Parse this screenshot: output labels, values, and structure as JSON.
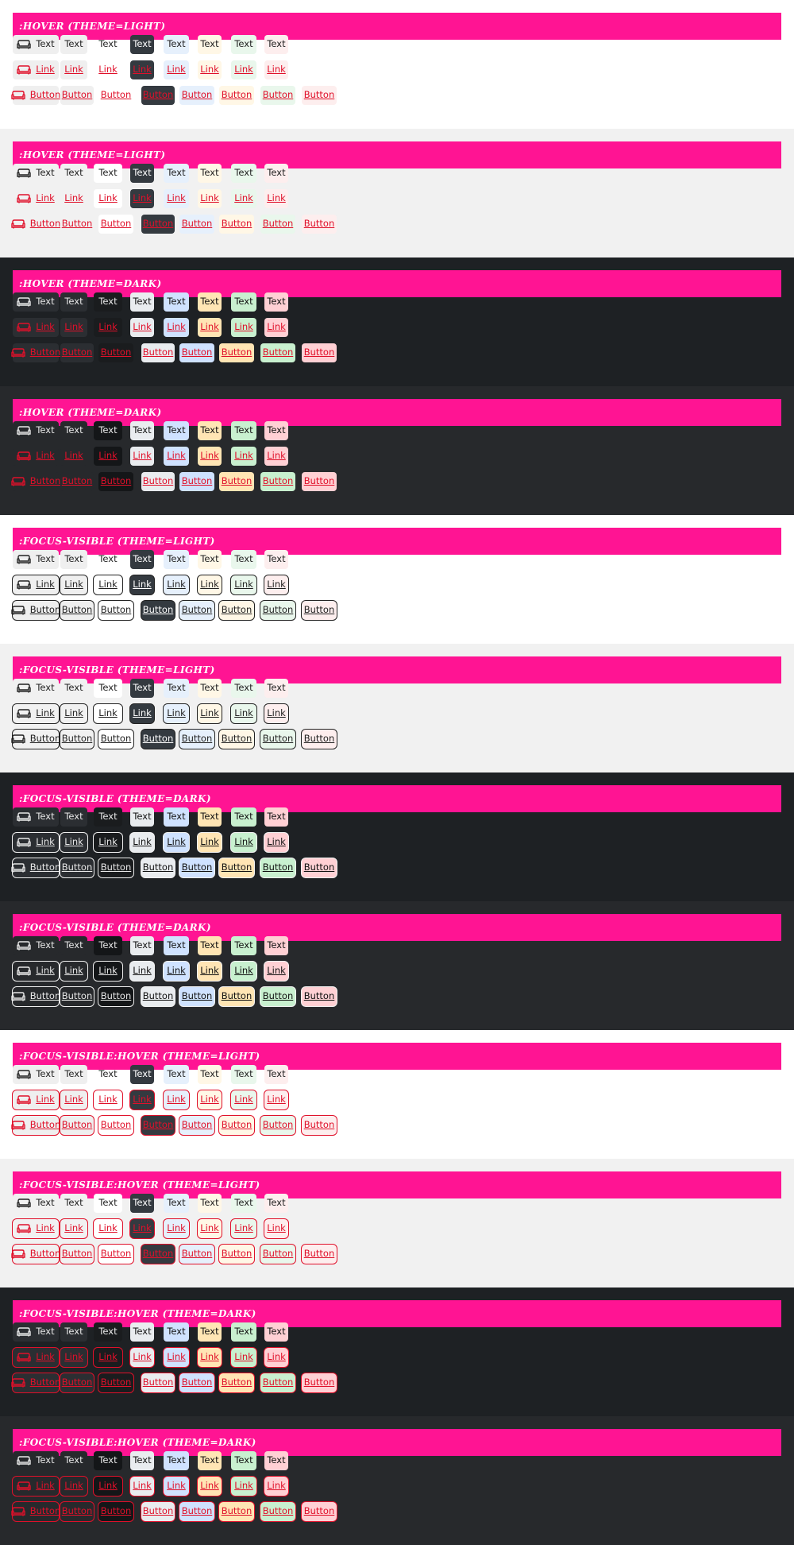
{
  "sections": [
    {
      "title": ":HOVER (THEME=LIGHT)",
      "theme": "light",
      "shade": "a",
      "focus": false,
      "hover": true
    },
    {
      "title": ":HOVER (THEME=LIGHT)",
      "theme": "light",
      "shade": "b",
      "focus": false,
      "hover": true
    },
    {
      "title": ":HOVER (THEME=DARK)",
      "theme": "dark",
      "shade": "a",
      "focus": false,
      "hover": true
    },
    {
      "title": ":HOVER (THEME=DARK)",
      "theme": "dark",
      "shade": "b",
      "focus": false,
      "hover": true
    },
    {
      "title": ":FOCUS-VISIBLE (THEME=LIGHT)",
      "theme": "light",
      "shade": "a",
      "focus": true,
      "hover": false
    },
    {
      "title": ":FOCUS-VISIBLE (THEME=LIGHT)",
      "theme": "light",
      "shade": "b",
      "focus": true,
      "hover": false
    },
    {
      "title": ":FOCUS-VISIBLE (THEME=DARK)",
      "theme": "dark",
      "shade": "a",
      "focus": true,
      "hover": false
    },
    {
      "title": ":FOCUS-VISIBLE (THEME=DARK)",
      "theme": "dark",
      "shade": "b",
      "focus": true,
      "hover": false
    },
    {
      "title": ":FOCUS-VISIBLE:HOVER (THEME=LIGHT)",
      "theme": "light",
      "shade": "a",
      "focus": true,
      "hover": true
    },
    {
      "title": ":FOCUS-VISIBLE:HOVER (THEME=LIGHT)",
      "theme": "light",
      "shade": "b",
      "focus": true,
      "hover": true
    },
    {
      "title": ":FOCUS-VISIBLE:HOVER (THEME=DARK)",
      "theme": "dark",
      "shade": "a",
      "focus": true,
      "hover": true
    },
    {
      "title": ":FOCUS-VISIBLE:HOVER (THEME=DARK)",
      "theme": "dark",
      "shade": "b",
      "focus": true,
      "hover": true
    }
  ],
  "rows": [
    {
      "kind": "text",
      "label": "Text"
    },
    {
      "kind": "link",
      "label": "Link"
    },
    {
      "kind": "button",
      "label": "Button"
    }
  ],
  "icon": "sofa-icon",
  "colors": {
    "banner": "#ff1493",
    "hover_text": "#e0102a"
  }
}
